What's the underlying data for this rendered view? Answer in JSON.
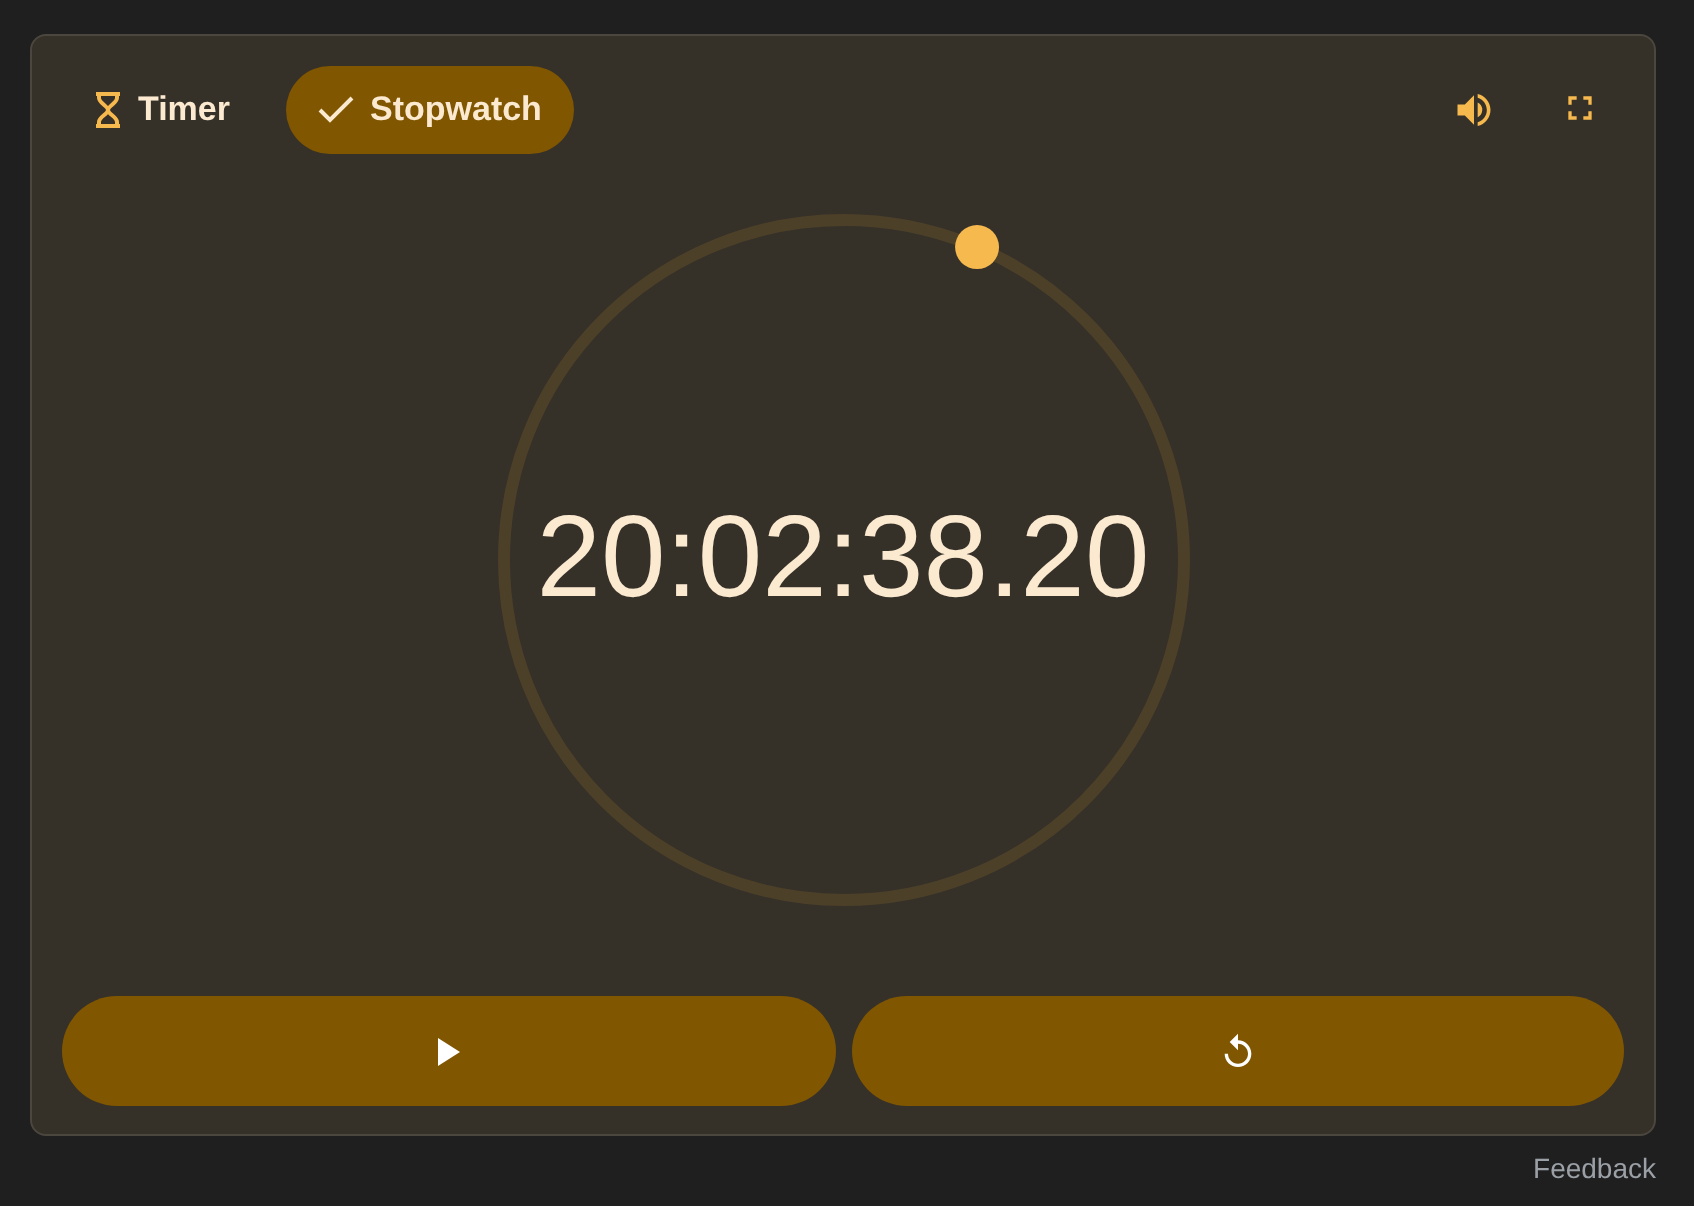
{
  "tabs": [
    {
      "label": "Timer",
      "selected": false
    },
    {
      "label": "Stopwatch",
      "selected": true
    }
  ],
  "display": {
    "time": "20:02:38.20"
  },
  "feedback": "Feedback"
}
